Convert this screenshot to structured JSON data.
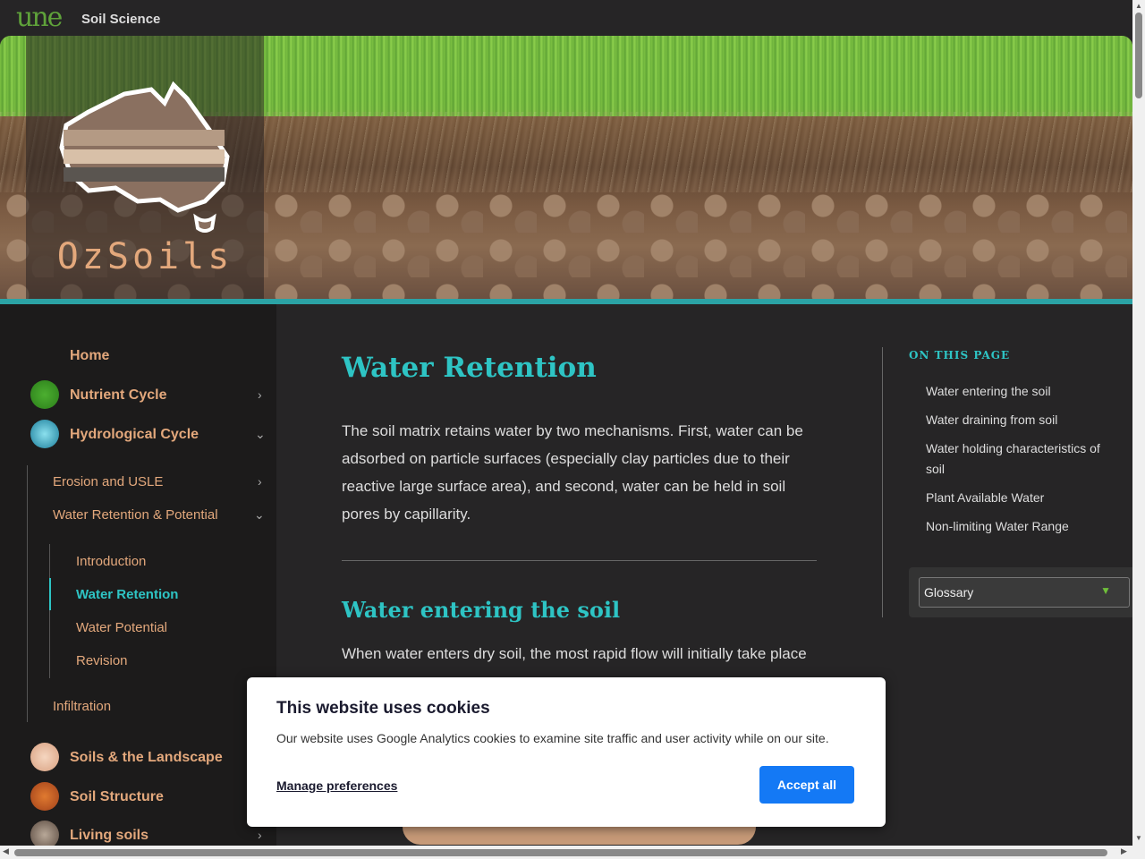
{
  "topbar": {
    "logo": "une",
    "site": "Soil Science"
  },
  "hero": {
    "brand": "OzSoils"
  },
  "sidebar": {
    "home": "Home",
    "nutrient": "Nutrient Cycle",
    "hydro": "Hydrological Cycle",
    "erosion": "Erosion and USLE",
    "water_ret": "Water Retention & Potential",
    "intro": "Introduction",
    "water_retention": "Water Retention",
    "water_potential": "Water Potential",
    "revision": "Revision",
    "infiltration": "Infiltration",
    "landscape": "Soils & the Landscape",
    "structure": "Soil Structure",
    "living": "Living soils"
  },
  "main": {
    "title": "Water Retention",
    "para": "The soil matrix retains water by two mechanisms. First, water can be adsorbed on particle surfaces (especially clay particles due to their reactive large surface area), and second, water can be held in soil pores by capillarity.",
    "h2": "Water entering the soil",
    "para2": "When water enters dry soil, the most rapid flow will initially take place"
  },
  "toc": {
    "heading": "ON THIS PAGE",
    "items": [
      "Water entering the soil",
      "Water draining from soil",
      "Water holding characteristics of soil",
      "Plant Available Water",
      "Non-limiting Water Range"
    ],
    "glossary": "Glossary"
  },
  "cookie": {
    "title": "This website uses cookies",
    "text": "Our website uses Google Analytics cookies to examine site traffic and user activity while on our site.",
    "manage": "Manage preferences",
    "accept": "Accept all"
  }
}
